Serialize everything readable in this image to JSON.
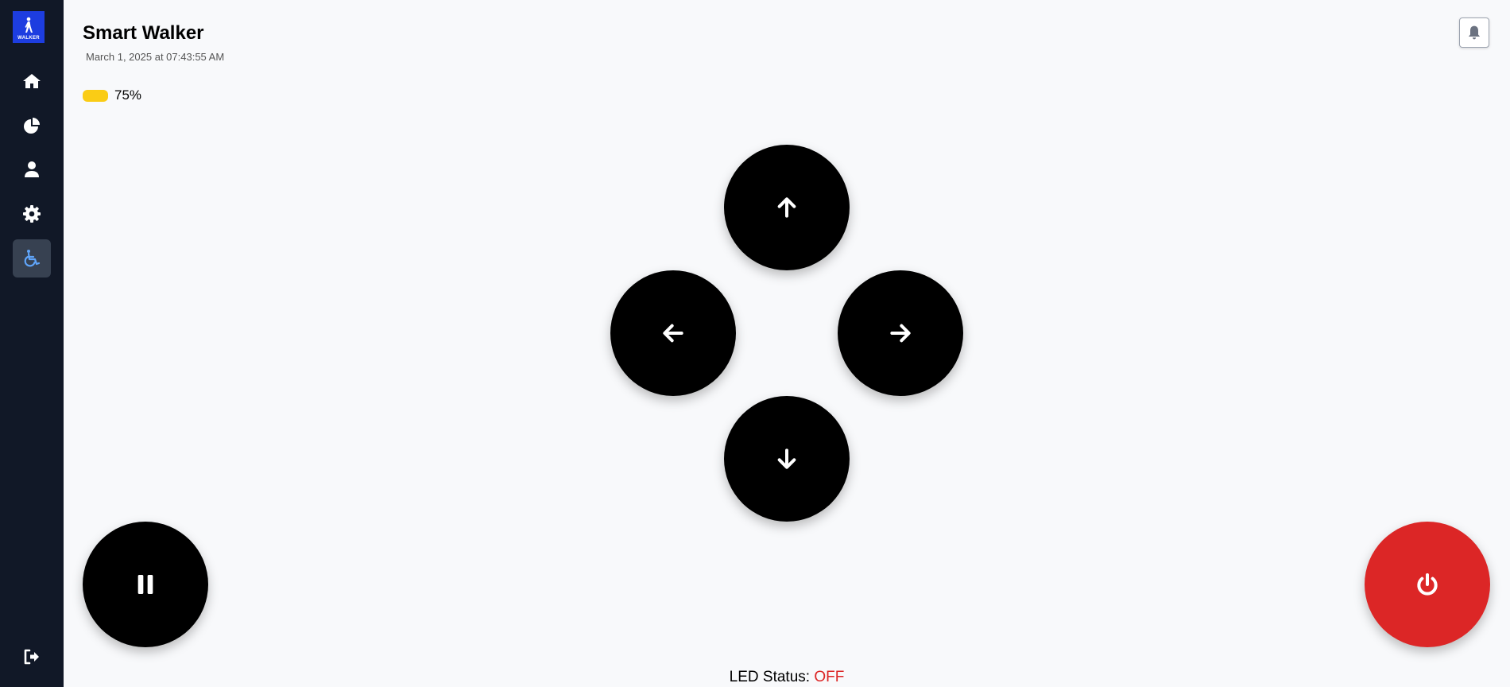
{
  "sidebar": {
    "logo_text": "WALKER",
    "items": [
      {
        "icon": "home-icon"
      },
      {
        "icon": "pie-chart-icon"
      },
      {
        "icon": "user-icon"
      },
      {
        "icon": "gear-icon"
      },
      {
        "icon": "wheelchair-icon",
        "active": true
      }
    ],
    "logout_icon": "logout-icon"
  },
  "header": {
    "title": "Smart Walker",
    "datetime": "March 1, 2025 at 07:43:55 AM",
    "battery_percent_label": "75%",
    "battery_level": 75,
    "battery_color": "#facc15"
  },
  "controls": {
    "up_icon": "arrow-up-icon",
    "down_icon": "arrow-down-icon",
    "left_icon": "arrow-left-icon",
    "right_icon": "arrow-right-icon",
    "pause_icon": "pause-icon",
    "power_icon": "power-icon",
    "power_color": "#dc2626"
  },
  "led": {
    "label": "LED Status:",
    "value": "OFF"
  }
}
